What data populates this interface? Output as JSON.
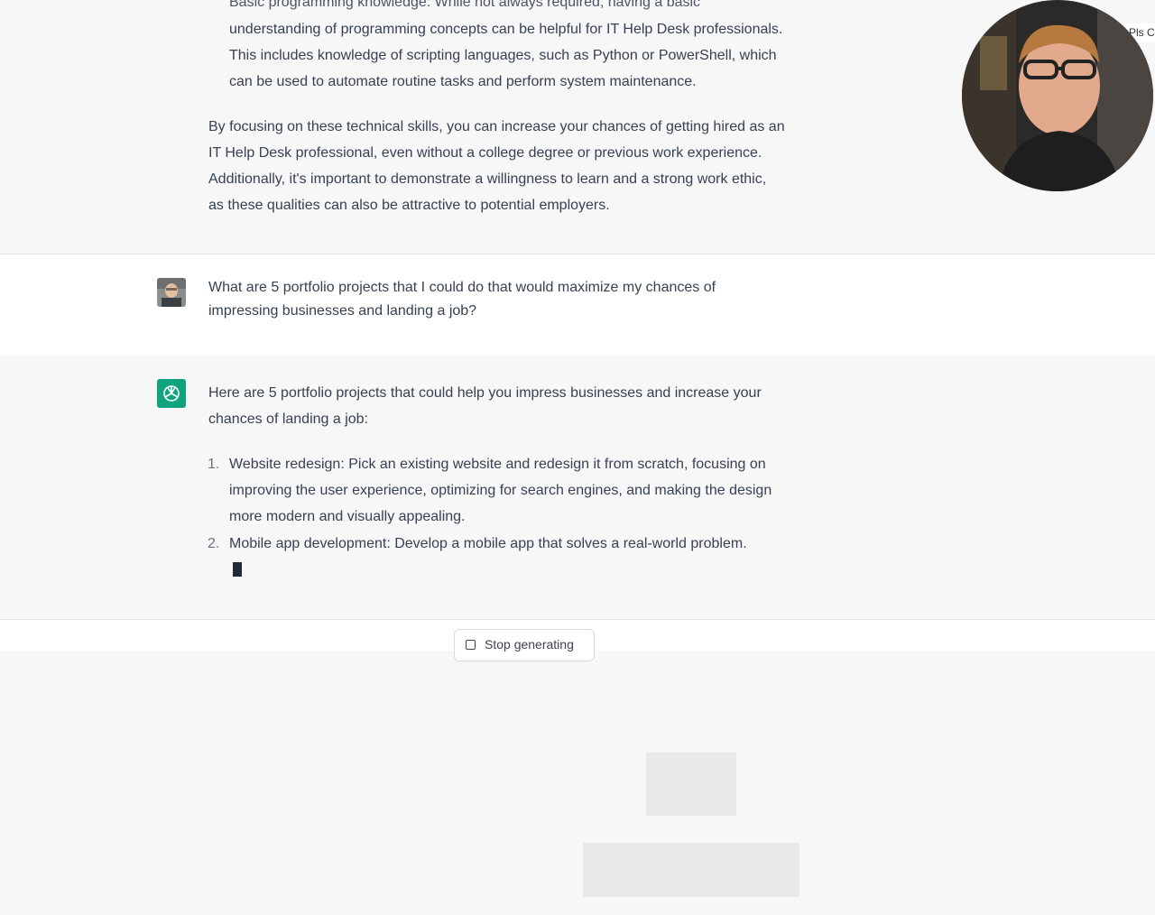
{
  "top_cut_text": "Basic programming knowledge: While not always required, having a basic",
  "top_item_continuation": {
    "line1": "understanding of programming concepts can be helpful for IT Help Desk professionals.",
    "line2": "This includes knowledge of scripting languages, such as Python or PowerShell, which",
    "line3": "can be used to automate routine tasks and perform system maintenance."
  },
  "summary_paragraph": {
    "line1": "By focusing on these technical skills, you can increase your chances of getting hired as an",
    "line2": "IT Help Desk professional, even without a college degree or previous work experience.",
    "line3": "Additionally, it's important to demonstrate a willingness to learn and a strong work ethic,",
    "line4": "as these qualities can also be attractive to potential employers."
  },
  "user_message": {
    "line1": "What are 5 portfolio projects that I could do that would maximize my chances of",
    "line2": "impressing businesses and landing a job?"
  },
  "assistant_reply": {
    "intro_line1": "Here are 5 portfolio projects that could help you impress businesses and increase your",
    "intro_line2": "chances of landing a job:",
    "items": [
      {
        "num": "1.",
        "line1": "Website redesign: Pick an existing website and redesign it from scratch, focusing on",
        "line2": "improving the user experience, optimizing for search engines, and making the design",
        "line3": "more modern and visually appealing."
      },
      {
        "num": "2.",
        "line1": "Mobile app development: Develop a mobile app that solves a real-world problem."
      }
    ]
  },
  "stop_button": {
    "label": "Stop generating"
  },
  "corner_tag": "Pls C",
  "colors": {
    "assistant_bg": "#f7f7f8",
    "user_bg": "#ffffff",
    "gpt_green": "#10a37f"
  }
}
